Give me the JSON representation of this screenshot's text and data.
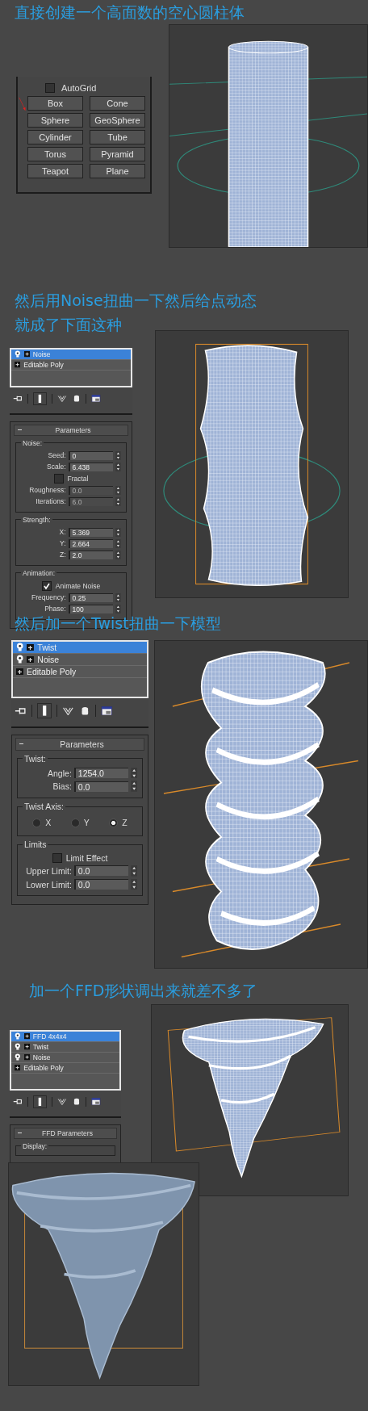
{
  "step_1": {
    "title": "直接创建一个高面数的空心圆柱体",
    "object_type": {
      "autogrid": {
        "label": "AutoGrid",
        "checked": false
      },
      "buttons": [
        "Box",
        "Cone",
        "Sphere",
        "GeoSphere",
        "Cylinder",
        "Tube",
        "Torus",
        "Pyramid",
        "Teapot",
        "Plane"
      ]
    }
  },
  "modifier_steps": [
    {
      "title_lines": [
        "然后用Noise扭曲一下然后给点动态",
        "就成了下面这种"
      ],
      "modifier_stack": [
        {
          "kind": "modifier",
          "label": "Noise",
          "selected": true
        },
        {
          "kind": "base",
          "label": "Editable Poly",
          "selected": false
        }
      ],
      "rollout": {
        "title": "Parameters",
        "groups": [
          {
            "title": "Noise:",
            "rows": [
              {
                "kind": "spinner",
                "label": "Seed:",
                "value": "0",
                "disabled": false
              },
              {
                "kind": "spinner",
                "label": "Scale:",
                "value": "6.438",
                "disabled": false
              },
              {
                "kind": "checkbox",
                "label": "Fractal",
                "checked": false
              },
              {
                "kind": "spinner",
                "label": "Roughness:",
                "value": "0.0",
                "disabled": true
              },
              {
                "kind": "spinner",
                "label": "Iterations:",
                "value": "6.0",
                "disabled": true
              }
            ]
          },
          {
            "title": "Strength:",
            "rows": [
              {
                "kind": "spinner",
                "label": "X:",
                "value": "5.369",
                "disabled": false
              },
              {
                "kind": "spinner",
                "label": "Y:",
                "value": "2.664",
                "disabled": false
              },
              {
                "kind": "spinner",
                "label": "Z:",
                "value": "2.0",
                "disabled": false
              }
            ]
          },
          {
            "title": "Animation:",
            "rows": [
              {
                "kind": "checkbox",
                "label": "Animate Noise",
                "checked": true
              },
              {
                "kind": "spinner",
                "label": "Frequency:",
                "value": "0.25",
                "disabled": false
              },
              {
                "kind": "spinner",
                "label": "Phase:",
                "value": "100",
                "disabled": false
              }
            ]
          }
        ]
      }
    },
    {
      "title_lines": [
        "然后加一个Twist扭曲一下模型"
      ],
      "modifier_stack": [
        {
          "kind": "modifier",
          "label": "Twist",
          "selected": true
        },
        {
          "kind": "modifier",
          "label": "Noise",
          "selected": false
        },
        {
          "kind": "base",
          "label": "Editable Poly",
          "selected": false
        }
      ],
      "rollout": {
        "title": "Parameters",
        "groups": [
          {
            "title": "Twist:",
            "rows": [
              {
                "kind": "spinner",
                "label": "Angle:",
                "value": "1254.0",
                "disabled": false
              },
              {
                "kind": "spinner",
                "label": "Bias:",
                "value": "0.0",
                "disabled": false
              }
            ]
          },
          {
            "title": "Twist Axis:",
            "rows": [
              {
                "kind": "radios",
                "options": [
                  {
                    "label": "X",
                    "selected": false
                  },
                  {
                    "label": "Y",
                    "selected": false
                  },
                  {
                    "label": "Z",
                    "selected": true
                  }
                ]
              }
            ]
          },
          {
            "title": "Limits",
            "rows": [
              {
                "kind": "checkbox",
                "label": "Limit Effect",
                "checked": false
              },
              {
                "kind": "spinner",
                "label": "Upper Limit:",
                "value": "0.0",
                "disabled": false
              },
              {
                "kind": "spinner",
                "label": "Lower Limit:",
                "value": "0.0",
                "disabled": false
              }
            ]
          }
        ]
      }
    },
    {
      "title_lines": [
        "加一个FFD形状调出来就差不多了"
      ],
      "modifier_stack": [
        {
          "kind": "modifier",
          "label": "FFD 4x4x4",
          "selected": true
        },
        {
          "kind": "modifier",
          "label": "Twist",
          "selected": false
        },
        {
          "kind": "modifier",
          "label": "Noise",
          "selected": false
        },
        {
          "kind": "base",
          "label": "Editable Poly",
          "selected": false
        }
      ],
      "rollout": {
        "title": "FFD Parameters",
        "groups": [
          {
            "title": "Display:"
          }
        ]
      }
    }
  ]
}
